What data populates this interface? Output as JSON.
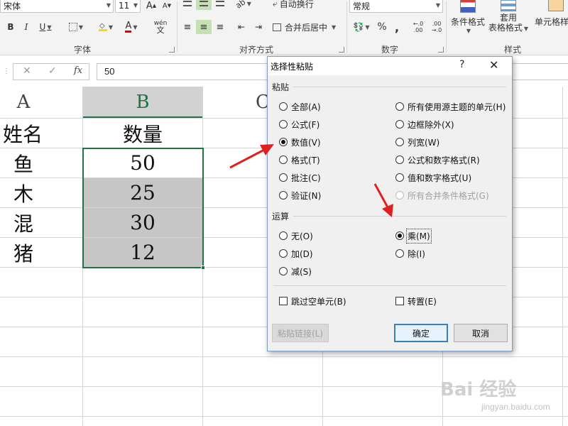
{
  "ribbon": {
    "font_name": "宋体",
    "font_size": "11",
    "bold": "B",
    "italic": "I",
    "underline": "U",
    "phonetic": "wén",
    "wrap_text": "自动换行",
    "merge_center": "合并后居中",
    "number_format": "常规",
    "percent": "%",
    "comma": ",",
    "inc_decimal": "←.0\n.00",
    "dec_decimal": ".00\n→.0",
    "conditional_format": "条件格式",
    "table_format_1": "套用",
    "table_format_2": "表格格式",
    "cell_styles": "单元格样式",
    "groups": {
      "font": "字体",
      "alignment": "对齐方式",
      "number": "数字",
      "styles": "样式"
    }
  },
  "formula_bar": {
    "fx": "fx",
    "value": "50"
  },
  "sheet": {
    "col_a": "A",
    "col_b": "B",
    "col_c": "C",
    "rows": [
      {
        "a": "姓名",
        "b": "数量"
      },
      {
        "a": "鱼",
        "b": "50"
      },
      {
        "a": "木",
        "b": "25"
      },
      {
        "a": "混",
        "b": "30"
      },
      {
        "a": "猪",
        "b": "12"
      }
    ]
  },
  "dialog": {
    "title": "选择性粘贴",
    "help": "?",
    "close": "✕",
    "paste_section": "粘贴",
    "paste_left": [
      "全部(A)",
      "公式(F)",
      "数值(V)",
      "格式(T)",
      "批注(C)",
      "验证(N)"
    ],
    "paste_right": [
      "所有使用源主题的单元(H)",
      "边框除外(X)",
      "列宽(W)",
      "公式和数字格式(R)",
      "值和数字格式(U)",
      "所有合并条件格式(G)"
    ],
    "paste_selected": "数值(V)",
    "operation_section": "运算",
    "op_left": [
      "无(O)",
      "加(D)",
      "减(S)"
    ],
    "op_right": [
      "乘(M)",
      "除(I)"
    ],
    "op_selected": "乘(M)",
    "skip_blanks": "跳过空单元(B)",
    "transpose": "转置(E)",
    "paste_link": "粘贴链接(L)",
    "ok": "确定",
    "cancel": "取消"
  },
  "watermark": {
    "brand": "Bai 经验",
    "url": "jingyan.baidu.com"
  },
  "colors": {
    "accent_green": "#217346",
    "selection_fill": "#c6c6c6",
    "arrow_red": "#e02020",
    "dialog_border": "#7a9cc6"
  }
}
